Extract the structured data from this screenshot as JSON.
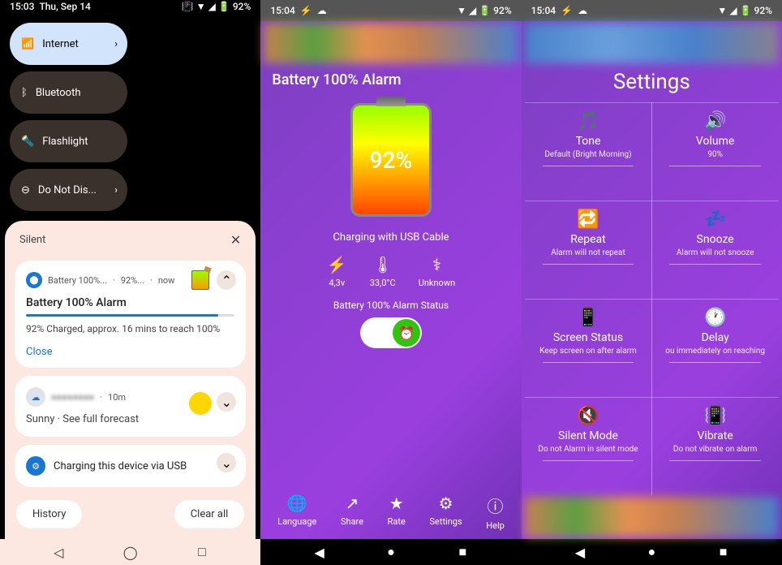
{
  "phone1": {
    "status": {
      "time": "15:03",
      "date": "Thu, Sep 14",
      "battery": "92%"
    },
    "tiles": {
      "internet": "Internet",
      "bluetooth": "Bluetooth",
      "flashlight": "Flashlight",
      "dnd": "Do Not Dis..."
    },
    "silent": "Silent",
    "notif1": {
      "app": "Battery 100%...",
      "pct": "92%...",
      "time": "now",
      "title": "Battery 100% Alarm",
      "body": "92% Charged, approx. 16 mins to reach 100%",
      "close": "Close"
    },
    "notif2": {
      "head": "■■■■■■■■",
      "time": "10m",
      "body": "Sunny · See full forecast"
    },
    "notif3": {
      "title": "Charging this device via USB"
    },
    "history": "History",
    "clearall": "Clear all"
  },
  "phone2": {
    "status": {
      "time": "15:04",
      "battery": "92%"
    },
    "title": "Battery 100% Alarm",
    "pct": "92%",
    "charging": "Charging with USB Cable",
    "stats": {
      "voltage": "4,3v",
      "temp": "33,0°C",
      "health": "Unknown"
    },
    "alarmstatus": "Battery 100% Alarm Status",
    "actions": {
      "language": "Language",
      "share": "Share",
      "rate": "Rate",
      "settings": "Settings",
      "help": "Help"
    }
  },
  "phone3": {
    "status": {
      "time": "15:04",
      "battery": "92%"
    },
    "title": "Settings",
    "cells": {
      "tone": {
        "label": "Tone",
        "sub": "Default (Bright Morning)"
      },
      "volume": {
        "label": "Volume",
        "sub": "90%"
      },
      "repeat": {
        "label": "Repeat",
        "sub": "Alarm will not repeat"
      },
      "snooze": {
        "label": "Snooze",
        "sub": "Alarm will not snooze"
      },
      "screen": {
        "label": "Screen Status",
        "sub": "Keep screen on after alarm"
      },
      "delay": {
        "label": "Delay",
        "sub": "ou immediately on reaching"
      },
      "silent": {
        "label": "Silent Mode",
        "sub": "Do not Alarm in silent mode"
      },
      "vibrate": {
        "label": "Vibrate",
        "sub": "Do not vibrate on alarm"
      }
    }
  }
}
